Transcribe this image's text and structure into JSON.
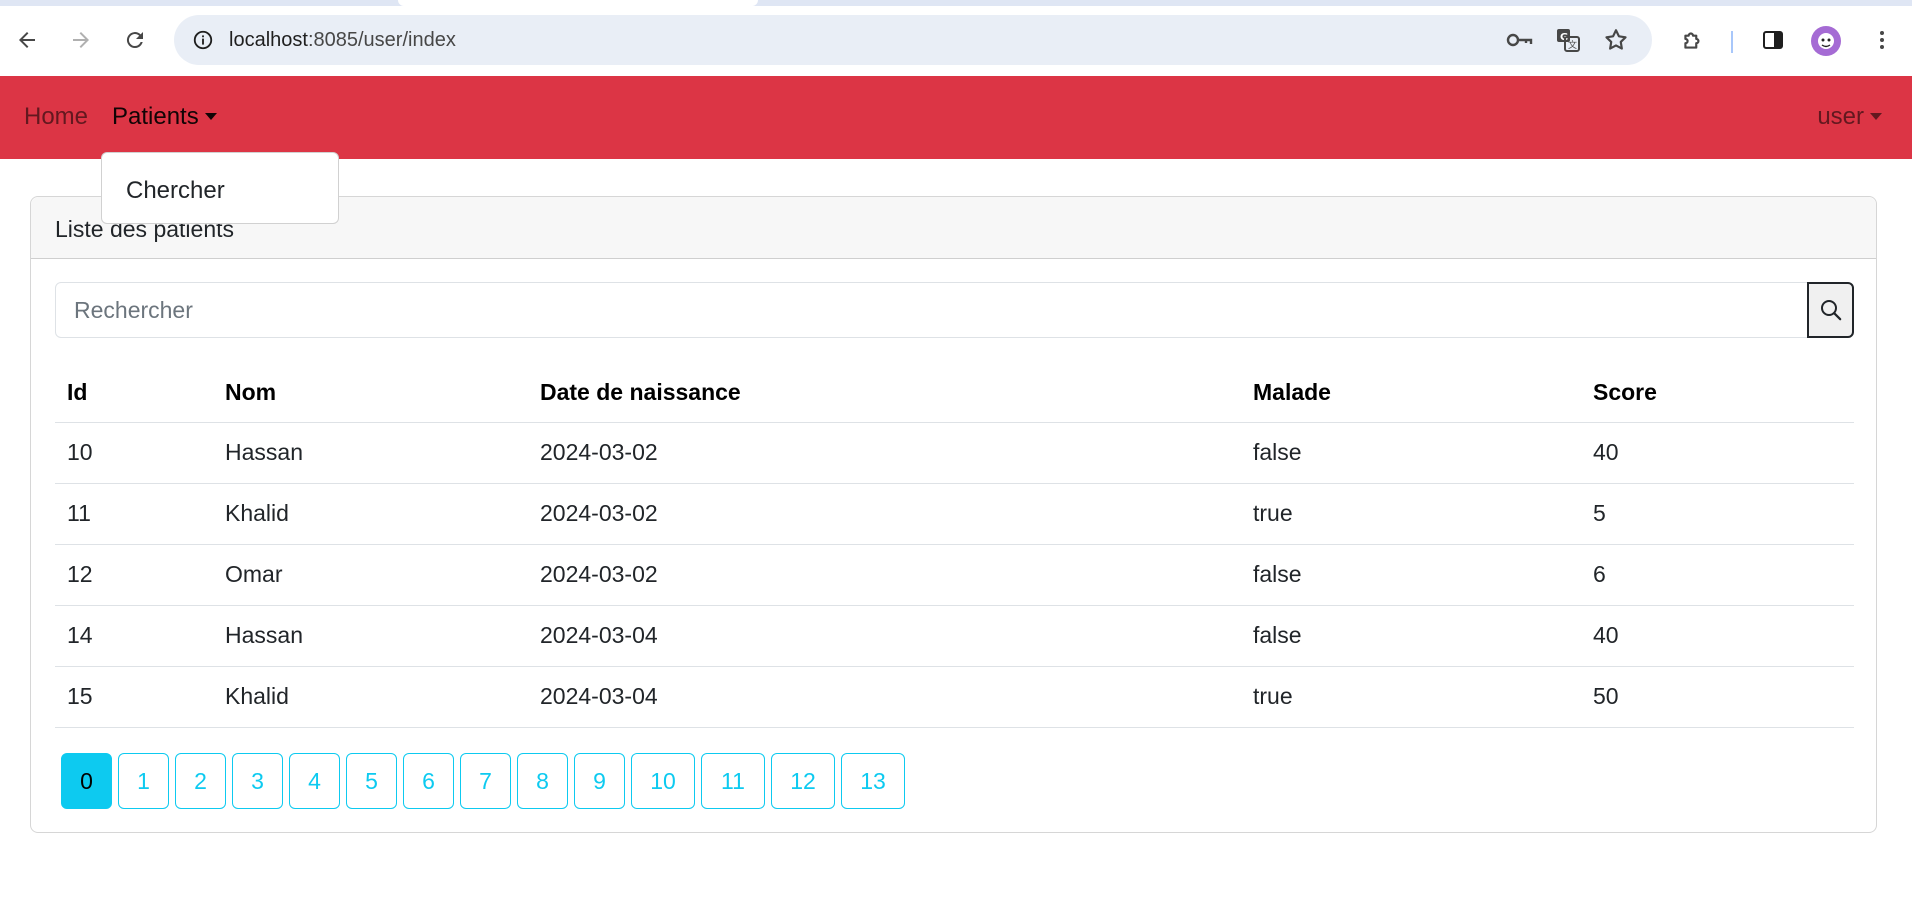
{
  "browser": {
    "url_host": "localhost",
    "url_rest": ":8085/user/index"
  },
  "navbar": {
    "home": "Home",
    "patients": "Patients",
    "user": "user",
    "dropdown_item": "Chercher",
    "color": "#dc3545"
  },
  "card": {
    "title": "Liste des patients",
    "search_placeholder": "Rechercher"
  },
  "table": {
    "headers": [
      "Id",
      "Nom",
      "Date de naissance",
      "Malade",
      "Score"
    ],
    "rows": [
      [
        "10",
        "Hassan",
        "2024-03-02",
        "false",
        "40"
      ],
      [
        "11",
        "Khalid",
        "2024-03-02",
        "true",
        "5"
      ],
      [
        "12",
        "Omar",
        "2024-03-02",
        "false",
        "6"
      ],
      [
        "14",
        "Hassan",
        "2024-03-04",
        "false",
        "40"
      ],
      [
        "15",
        "Khalid",
        "2024-03-04",
        "true",
        "50"
      ]
    ]
  },
  "pagination": {
    "pages": [
      "0",
      "1",
      "2",
      "3",
      "4",
      "5",
      "6",
      "7",
      "8",
      "9",
      "10",
      "11",
      "12",
      "13"
    ],
    "active": "0",
    "color": "#0dcaf0"
  }
}
